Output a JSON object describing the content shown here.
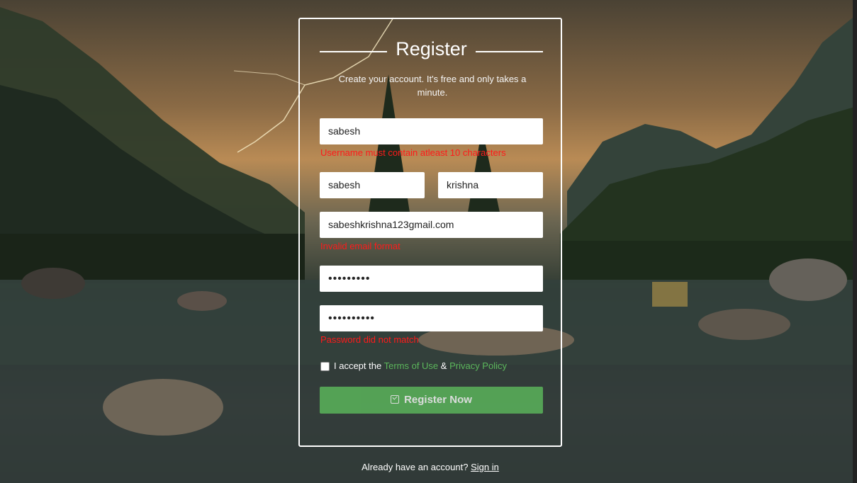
{
  "form": {
    "title": "Register",
    "subtitle": "Create your account. It's free and only takes a minute.",
    "username": {
      "value": "sabesh",
      "error": "Username must contain atleast 10 characters"
    },
    "first_name": {
      "value": "sabesh"
    },
    "last_name": {
      "value": "krishna"
    },
    "email": {
      "value": "sabeshkrishna123gmail.com",
      "error": "Invalid email format"
    },
    "password": {
      "masked": "•••••••••"
    },
    "confirm_password": {
      "masked": "••••••••••",
      "error": "Password did not match"
    },
    "terms": {
      "checked": false,
      "prefix": "I accept the ",
      "terms_link": "Terms of Use",
      "joiner": " & ",
      "privacy_link": "Privacy Policy"
    },
    "submit_label": "Register Now",
    "submit_icon": "check-square-icon"
  },
  "footer": {
    "prompt": "Already have an account?",
    "sign_in_link": "Sign in"
  },
  "colors": {
    "accent": "#5cb85c",
    "error": "#ff1a1a"
  }
}
